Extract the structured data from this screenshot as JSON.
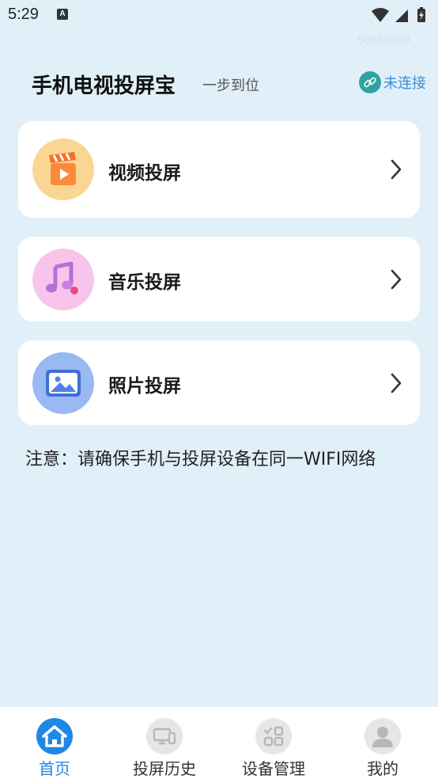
{
  "status_bar": {
    "time": "5:29",
    "notification": "A"
  },
  "watermark": "50854929",
  "header": {
    "title": "手机电视投屏宝",
    "subtitle": "一步到位",
    "connect_status": "未连接"
  },
  "cards": [
    {
      "label": "视频投屏",
      "icon": "video-clapper-icon"
    },
    {
      "label": "音乐投屏",
      "icon": "music-note-icon"
    },
    {
      "label": "照片投屏",
      "icon": "photo-icon"
    }
  ],
  "notice": "注意：请确保手机与投屏设备在同一WIFI网络",
  "tabbar": {
    "tabs": [
      {
        "label": "首页",
        "icon": "home-icon",
        "active": true
      },
      {
        "label": "投屏历史",
        "icon": "devices-icon",
        "active": false
      },
      {
        "label": "设备管理",
        "icon": "grid-check-icon",
        "active": false
      },
      {
        "label": "我的",
        "icon": "user-icon",
        "active": false
      }
    ]
  },
  "colors": {
    "background": "#e1eff8",
    "accent": "#1e88e5",
    "link_badge": "#2fa3a0",
    "video_icon_bg": "#fad694",
    "music_icon_bg": "#f7c5ec",
    "photo_icon_bg": "#9ab8f2"
  }
}
